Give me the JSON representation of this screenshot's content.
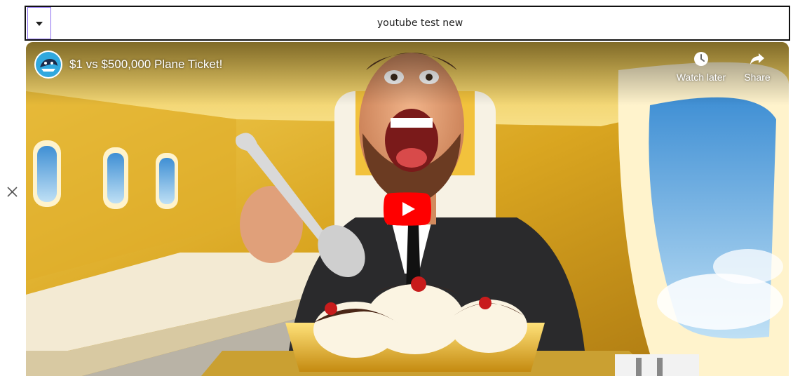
{
  "header": {
    "title": "youtube test new",
    "toggle_icon": "caret-down-icon"
  },
  "side_controls": {
    "close_icon": "close-icon",
    "menu_icon": "hamburger-menu-icon"
  },
  "video": {
    "title": "$1 vs $500,000 Plane Ticket!",
    "actions": [
      {
        "label": "Watch later",
        "icon": "clock-icon"
      },
      {
        "label": "Share",
        "icon": "share-arrow-icon"
      }
    ],
    "play_icon": "youtube-play-icon",
    "colors": {
      "brand_red": "#ff0000",
      "gold": "#d9a520",
      "cabin_cream": "#f3ead3",
      "sky": "#6fb5e6"
    }
  }
}
